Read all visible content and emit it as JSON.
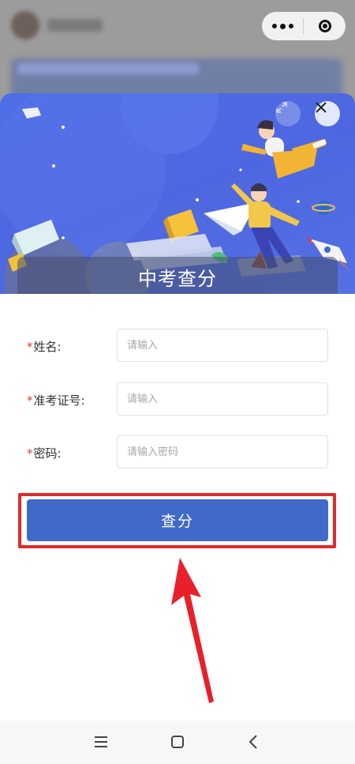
{
  "header": {
    "title": "中考查分"
  },
  "form": {
    "name_label": "姓名:",
    "name_placeholder": "请输入",
    "ticket_label": "准考证号:",
    "ticket_placeholder": "请输入",
    "password_label": "密码:",
    "password_placeholder": "请输入密码",
    "required_mark": "*"
  },
  "actions": {
    "query_label": "查分"
  },
  "icons": {
    "capsule_more": "more-dots-icon",
    "capsule_close": "target-icon",
    "expand": "expand-icon",
    "close": "close-icon",
    "nav_menu": "menu-icon",
    "nav_home": "home-square-icon",
    "nav_back": "back-chevron-icon"
  },
  "colors": {
    "primary_button": "#4169c9",
    "banner": "#4f6ee6",
    "required": "#e4392e",
    "highlight": "#e02a2a"
  }
}
